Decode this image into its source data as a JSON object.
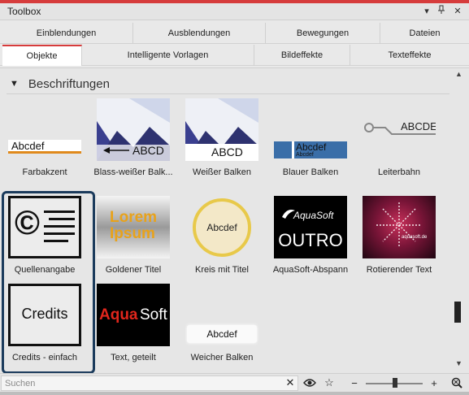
{
  "window": {
    "title": "Toolbox"
  },
  "tabs_row1": [
    "Einblendungen",
    "Ausblendungen",
    "Bewegungen",
    "Dateien"
  ],
  "tabs_row2": [
    "Objekte",
    "Intelligente Vorlagen",
    "Bildeffekte",
    "Texteffekte"
  ],
  "active_tab": "Objekte",
  "section": {
    "title": "Beschriftungen",
    "expanded": true
  },
  "items": [
    {
      "label": "Farbakzent",
      "thumb_text": "Abcdef"
    },
    {
      "label": "Blass-weißer Balk...",
      "thumb_text": "ABCD"
    },
    {
      "label": "Weißer Balken",
      "thumb_text": "ABCD"
    },
    {
      "label": "Blauer Balken",
      "thumb_text": "Abcdef",
      "thumb_text2": "Abcdef"
    },
    {
      "label": "Leiterbahn",
      "thumb_text": "ABCDE"
    },
    {
      "label": "Quellenangabe",
      "thumb_text": "©"
    },
    {
      "label": "Goldener Titel",
      "thumb_text": "Lorem",
      "thumb_text2": "Ipsum"
    },
    {
      "label": "Kreis mit Titel",
      "thumb_text": "Abcdef"
    },
    {
      "label": "AquaSoft-Abspann",
      "thumb_text": "AquaSoft",
      "thumb_text2": "OUTRO"
    },
    {
      "label": "Rotierender Text",
      "thumb_text": "aquasoft.de"
    },
    {
      "label": "Credits - einfach",
      "thumb_text": "Credits"
    },
    {
      "label": "Text, geteilt",
      "thumb_text": "Aqua",
      "thumb_text2": "Soft"
    },
    {
      "label": "Weicher Balken",
      "thumb_text": "Abcdef"
    }
  ],
  "selected_items": [
    "Quellenangabe",
    "Credits - einfach"
  ],
  "search": {
    "placeholder": "Suchen",
    "value": ""
  },
  "colors": {
    "accent": "#d63c3c",
    "selection": "#1b3b5c"
  }
}
